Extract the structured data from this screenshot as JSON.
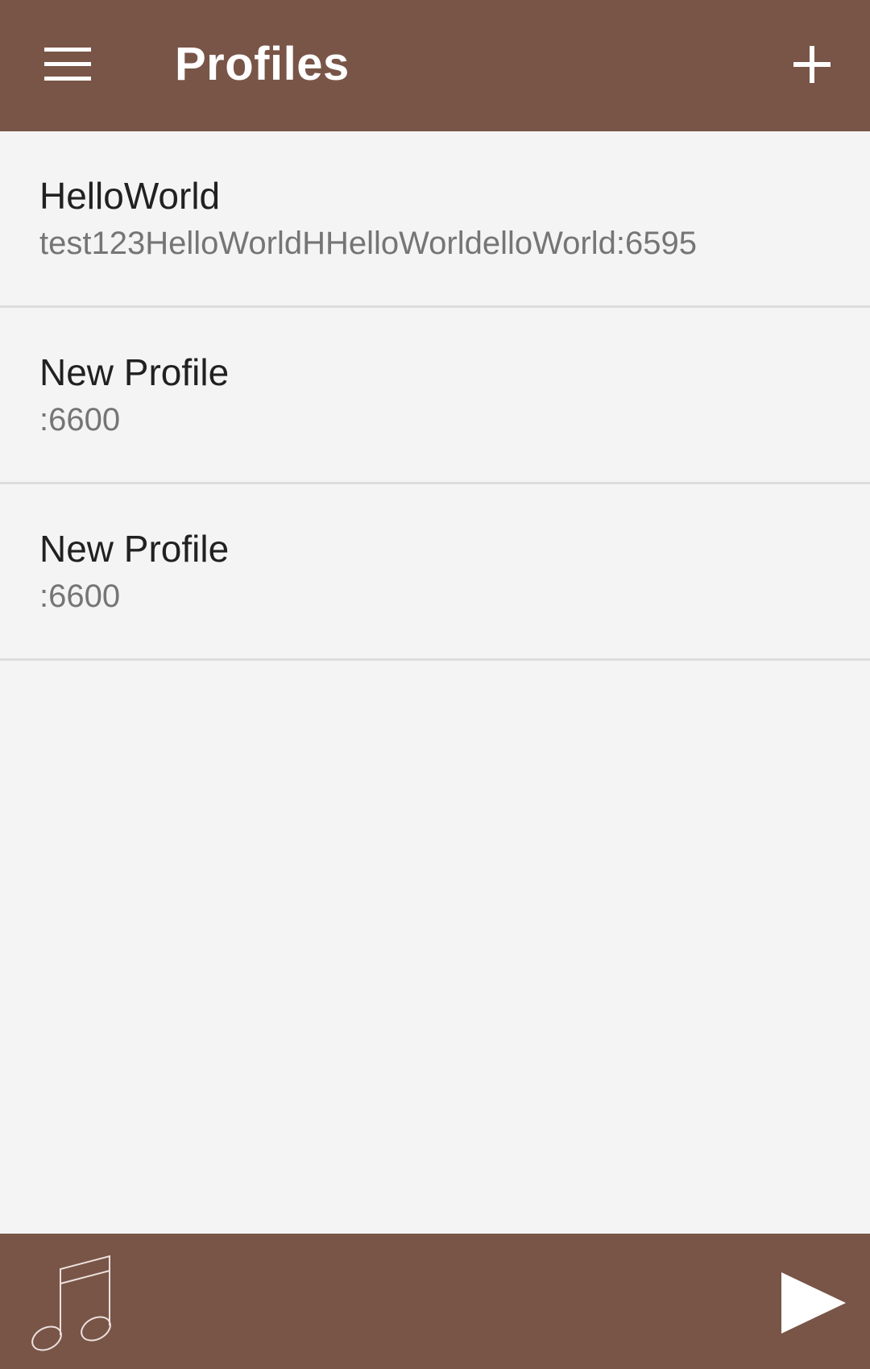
{
  "appbar": {
    "title": "Profiles",
    "menu_icon": "menu-icon",
    "add_icon": "plus-icon"
  },
  "profiles": [
    {
      "name": "HelloWorld",
      "detail": "test123HelloWorldHHelloWorldelloWorld:6595"
    },
    {
      "name": "New Profile",
      "detail": ":6600"
    },
    {
      "name": "New Profile",
      "detail": ":6600"
    }
  ],
  "bottombar": {
    "music_icon": "music-note-icon",
    "play_icon": "play-icon"
  },
  "colors": {
    "primary": "#795548",
    "background": "#f4f4f4",
    "divider": "#dddddd",
    "title_text": "#212121",
    "secondary_text": "#757575"
  }
}
